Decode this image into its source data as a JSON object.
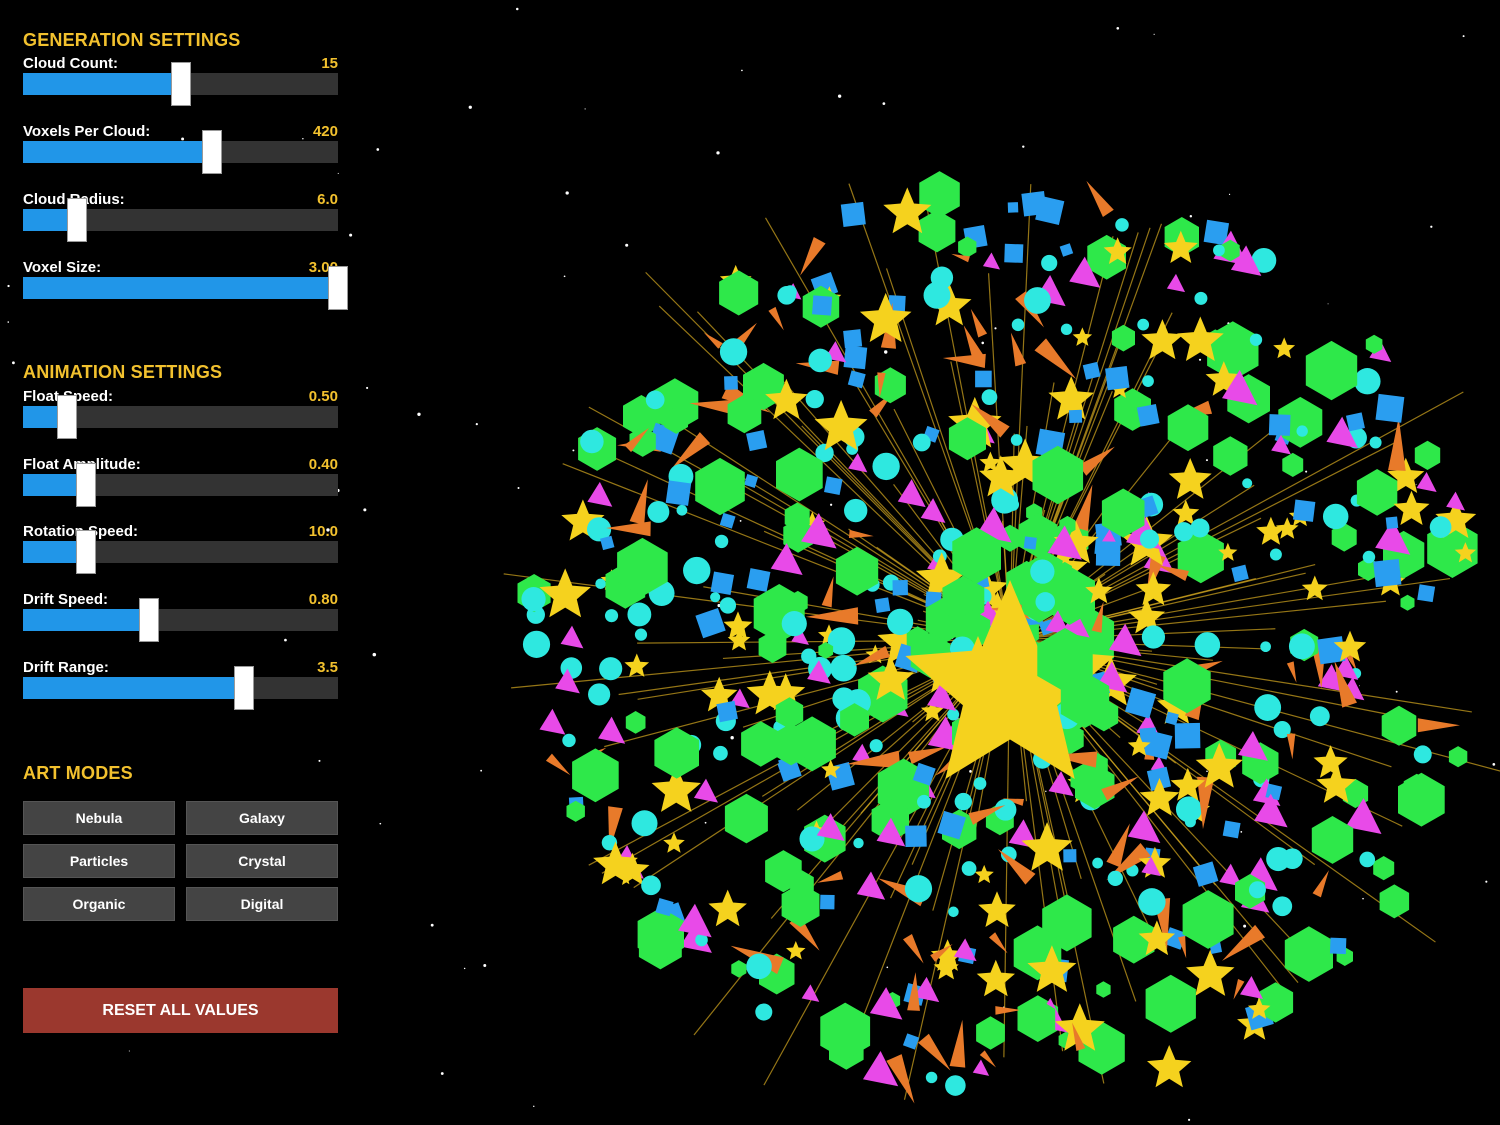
{
  "generation": {
    "title": "GENERATION SETTINGS",
    "sliders": [
      {
        "label": "Cloud Count:",
        "value": "15",
        "fraction": 0.5
      },
      {
        "label": "Voxels Per Cloud:",
        "value": "420",
        "fraction": 0.6
      },
      {
        "label": "Cloud Radius:",
        "value": "6.0",
        "fraction": 0.17
      },
      {
        "label": "Voxel Size:",
        "value": "3.00",
        "fraction": 1.0
      }
    ]
  },
  "animation": {
    "title": "ANIMATION SETTINGS",
    "sliders": [
      {
        "label": "Float Speed:",
        "value": "0.50",
        "fraction": 0.14
      },
      {
        "label": "Float Amplitude:",
        "value": "0.40",
        "fraction": 0.2
      },
      {
        "label": "Rotation Speed:",
        "value": "10.0",
        "fraction": 0.2
      },
      {
        "label": "Drift Speed:",
        "value": "0.80",
        "fraction": 0.4
      },
      {
        "label": "Drift Range:",
        "value": "3.5",
        "fraction": 0.7
      }
    ]
  },
  "art_modes": {
    "title": "ART MODES",
    "buttons": [
      "Nebula",
      "Galaxy",
      "Particles",
      "Crystal",
      "Organic",
      "Digital"
    ]
  },
  "reset_label": "RESET ALL VALUES",
  "colors": {
    "accent": "#f2c12e",
    "slider_fill": "#2196e8",
    "reset": "#9b382e",
    "voxel_green": "#2ee84a",
    "voxel_cyan": "#2ee8e0",
    "voxel_blue": "#2a9ef0",
    "voxel_yellow": "#f5d21e",
    "voxel_magenta": "#e84ae8",
    "voxel_orange": "#e87a2a"
  }
}
